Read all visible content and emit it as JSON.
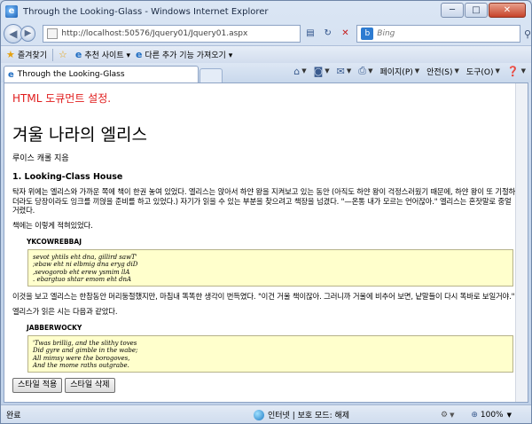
{
  "window": {
    "title": "Through the Looking-Glass - Windows Internet Explorer",
    "min": "─",
    "max": "□",
    "close": "✕"
  },
  "address": {
    "url": "http://localhost:50576/Jquery01/Jquery01.aspx",
    "search_placeholder": "Bing"
  },
  "favbar": {
    "favorites": "즐겨찾기",
    "suggested": "추천 사이트 ▾",
    "addons": "다른 추가 기능 가져오기 ▾"
  },
  "tab": {
    "label": "Through the Looking-Glass"
  },
  "commands": {
    "page": "페이지(P)",
    "safety": "안전(S)",
    "tools": "도구(O)"
  },
  "page": {
    "red_title": "HTML 도큐먼트 설정.",
    "heading": "겨울 나라의 엘리스",
    "author": "루이스 캐롤 지음",
    "chapter": "1. Looking-Class House",
    "para1": "탁자 위에는 엘리스와 가까운 쪽에 책이 한권 놓여 있었다. 엘리스는 앉아서 하얀 왕을 지켜보고 있는 동안 (아직도 하얀 왕이 걱정스러웠기 때문에, 하얀 왕이 또 기절하더라도 당장이라도 잉크를 끼얹을 준비를 하고 있었다.) 자기가 읽을 수 있는 부분을 찾으려고 책장을 넘겼다. \"—온통 내가 모르는 언어잖아.\" 엘리스는 혼잣말로 중얼거렸다.",
    "para2": "책에는 이렇게 적혀있었다.",
    "poem1_title": "YKCOWREBBAJ",
    "poem1": [
      "sevot yhtils eht dna, gillird sawT'",
      ";ebaw eht ni elbmig dna eryg diD",
      ",sevogorob eht erew ysmim llA",
      ". ebargtuo shtar emom eht dnA"
    ],
    "para3": "이것을 보고 엘리스는 한참동안 머리둥절했지만, 마침내 똑똑한 생각이 번득였다. \"이건 거울 책이잖아. 그러니까 거울에 비추어 보면, 낱말들이 다시 똑바로 보일거야.\"",
    "para4": "엘리스가 읽은 시는 다음과 같았다.",
    "poem2_title": "JABBERWOCKY",
    "poem2": [
      "'Twas brillig, and the slithy toves",
      "Did gyre and gimble in the wabe;",
      "All mimsy were the borogoves,",
      "And the mome raths outgrabe."
    ],
    "btn_apply": "스타일 적용",
    "btn_remove": "스타일 삭제"
  },
  "status": {
    "done": "완료",
    "zone": "인터넷 | 보호 모드: 해제",
    "zoom": "100%"
  }
}
